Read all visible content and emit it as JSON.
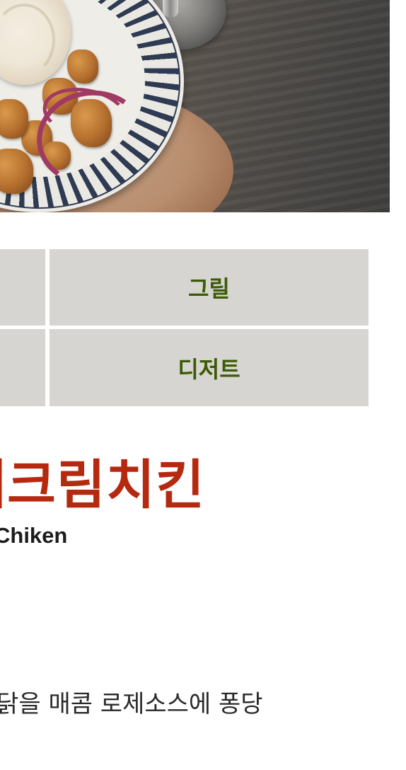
{
  "hero": {
    "image_alt_name": "chicken-dish-photo"
  },
  "category_grid": {
    "cells": [
      {
        "label": ""
      },
      {
        "label": "그릴"
      },
      {
        "label": ""
      },
      {
        "label": "디저트"
      }
    ],
    "cell_bg": "#d6d5d1",
    "text_color": "#3d5a06"
  },
  "product": {
    "title": "로제크림치킨",
    "subtitle": "Chiken",
    "description": "- 닭을 매콤 로제소스에 퐁당",
    "title_color": "#b5290f"
  }
}
